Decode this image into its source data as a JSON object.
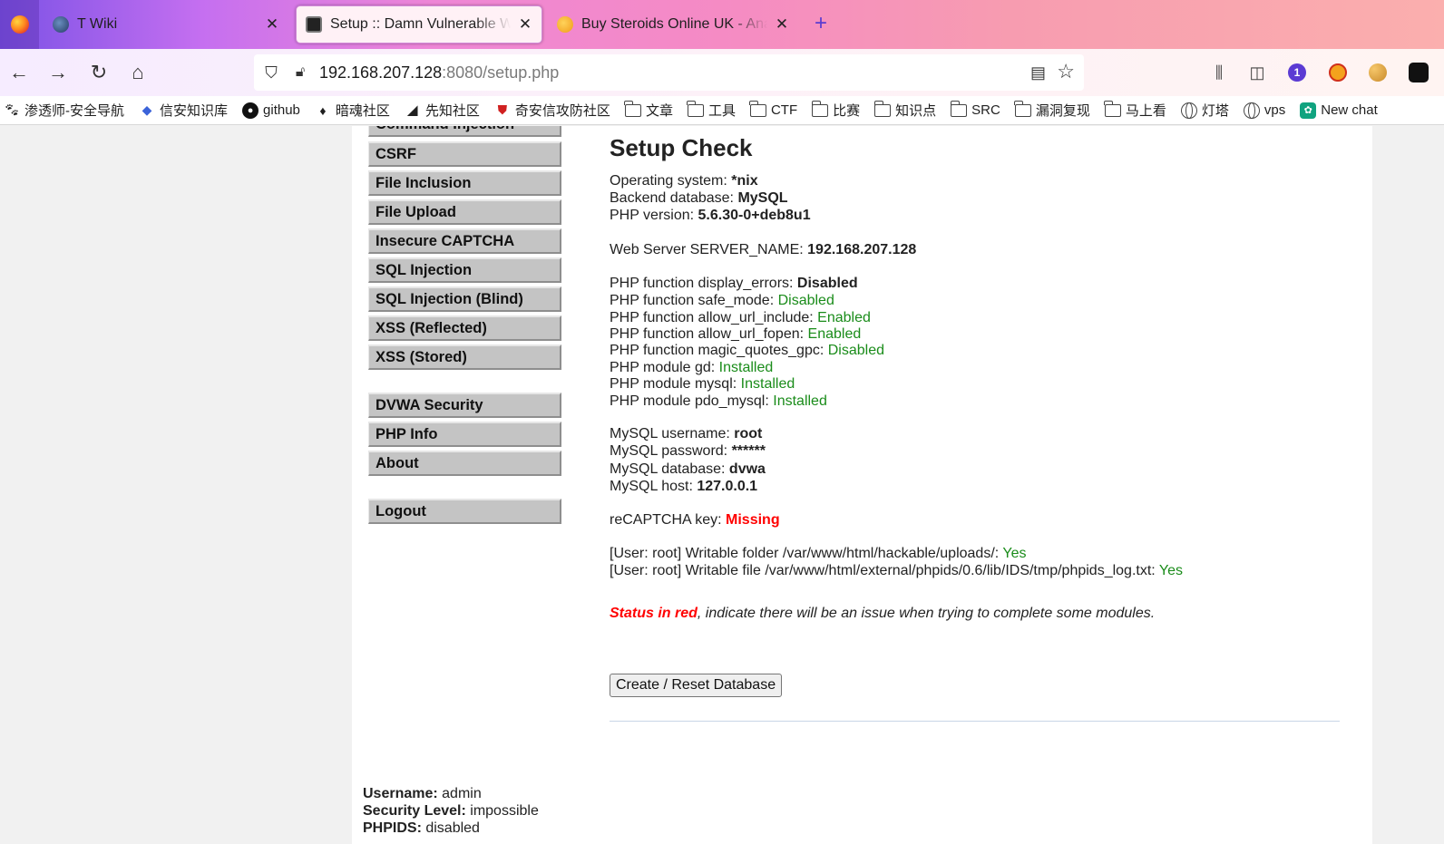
{
  "browser": {
    "tabs": [
      {
        "title": "T Wiki",
        "active": false
      },
      {
        "title": "Setup :: Damn Vulnerable Web Application",
        "active": true
      },
      {
        "title": "Buy Steroids Online UK - Anabolic",
        "active": false
      }
    ],
    "url": {
      "host": "192.168.207.128",
      "rest": ":8080/setup.php"
    },
    "bookmarks": [
      {
        "label": "渗透师-安全导航",
        "icon": "paw-icon"
      },
      {
        "label": "信安知识库",
        "icon": "diamond-icon"
      },
      {
        "label": "github",
        "icon": "github-icon"
      },
      {
        "label": "暗魂社区",
        "icon": "flame-icon"
      },
      {
        "label": "先知社区",
        "icon": "slash-icon"
      },
      {
        "label": "奇安信攻防社区",
        "icon": "shield-icon"
      },
      {
        "label": "文章",
        "icon": "folder-icon"
      },
      {
        "label": "工具",
        "icon": "folder-icon"
      },
      {
        "label": "CTF",
        "icon": "folder-icon"
      },
      {
        "label": "比赛",
        "icon": "folder-icon"
      },
      {
        "label": "知识点",
        "icon": "folder-icon"
      },
      {
        "label": "SRC",
        "icon": "folder-icon"
      },
      {
        "label": "漏洞复现",
        "icon": "folder-icon"
      },
      {
        "label": "马上看",
        "icon": "folder-icon"
      },
      {
        "label": "灯塔",
        "icon": "globe-icon"
      },
      {
        "label": "vps",
        "icon": "globe-icon"
      },
      {
        "label": "New chat",
        "icon": "chatgpt-icon"
      }
    ],
    "extension_badge": "1"
  },
  "menu": {
    "partial_top": "Command Injection",
    "items": [
      "CSRF",
      "File Inclusion",
      "File Upload",
      "Insecure CAPTCHA",
      "SQL Injection",
      "SQL Injection (Blind)",
      "XSS (Reflected)",
      "XSS (Stored)"
    ],
    "items2": [
      "DVWA Security",
      "PHP Info",
      "About"
    ],
    "logout": "Logout"
  },
  "setup": {
    "title": "Setup Check",
    "os_label": "Operating system: ",
    "os_value": "*nix",
    "db_label": "Backend database: ",
    "db_value": "MySQL",
    "php_label": "PHP version: ",
    "php_value": "5.6.30-0+deb8u1",
    "server_label": "Web Server SERVER_NAME: ",
    "server_value": "192.168.207.128",
    "php_checks": [
      {
        "label": "PHP function display_errors: ",
        "value": "Disabled"
      },
      {
        "label": "PHP function safe_mode: ",
        "value": "Disabled"
      },
      {
        "label": "PHP function allow_url_include: ",
        "value": "Enabled"
      },
      {
        "label": "PHP function allow_url_fopen: ",
        "value": "Enabled"
      },
      {
        "label": "PHP function magic_quotes_gpc: ",
        "value": "Disabled"
      },
      {
        "label": "PHP module gd: ",
        "value": "Installed"
      },
      {
        "label": "PHP module mysql: ",
        "value": "Installed"
      },
      {
        "label": "PHP module pdo_mysql: ",
        "value": "Installed"
      }
    ],
    "mysql": [
      {
        "label": "MySQL username: ",
        "value": "root"
      },
      {
        "label": "MySQL password: ",
        "value": "******"
      },
      {
        "label": "MySQL database: ",
        "value": "dvwa"
      },
      {
        "label": "MySQL host: ",
        "value": "127.0.0.1"
      }
    ],
    "recaptcha_label": "reCAPTCHA key: ",
    "recaptcha_value": "Missing",
    "writable": [
      {
        "label": "[User: root] Writable folder /var/www/html/hackable/uploads/: ",
        "value": "Yes"
      },
      {
        "label": "[User: root] Writable file /var/www/html/external/phpids/0.6/lib/IDS/tmp/phpids_log.txt: ",
        "value": "Yes"
      }
    ],
    "status_red": "Status in red",
    "status_rest": ", indicate there will be an issue when trying to complete some modules.",
    "create_button": "Create / Reset Database"
  },
  "user": {
    "username_label": "Username:",
    "username": " admin",
    "security_label": "Security Level:",
    "security": " impossible",
    "phpids_label": "PHPIDS:",
    "phpids": " disabled"
  },
  "colors": {
    "ok": "#1a8c1a",
    "bad": "#ff0000",
    "menu_bg": "#c4c4c4"
  }
}
